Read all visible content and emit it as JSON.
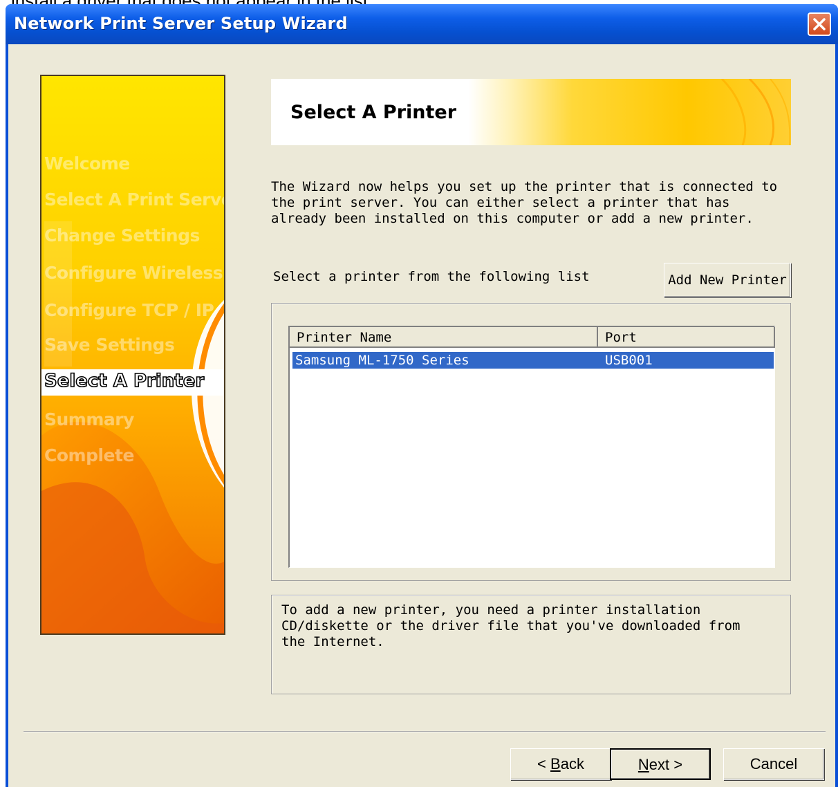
{
  "overflow_text": "install a driver that does not appear in the list.",
  "window": {
    "title": "Network Print Server Setup Wizard"
  },
  "sidebar": {
    "steps": [
      {
        "label": "Welcome"
      },
      {
        "label": "Select A Print Server"
      },
      {
        "label": "Change Settings"
      },
      {
        "label": "Configure Wireless"
      },
      {
        "label": "Configure  TCP / IP"
      },
      {
        "label": "Save Settings"
      },
      {
        "label": "Select A Printer"
      },
      {
        "label": "Summary"
      },
      {
        "label": "Complete"
      }
    ],
    "active_step": "Select A Printer"
  },
  "header": {
    "title": "Select A Printer"
  },
  "description": "The Wizard now helps you set up the printer that is connected to\nthe print server. You can either select a printer that has\nalready been installed on this computer or add a new printer.",
  "printer_list": {
    "label": "Select a printer from the following list",
    "add_button": "Add New Printer",
    "columns": [
      "Printer Name",
      "Port"
    ],
    "rows": [
      {
        "name": "Samsung ML-1750 Series",
        "port": "USB001",
        "selected": true
      }
    ]
  },
  "note": "To add a new printer, you need a printer installation\nCD/diskette or the driver file that you've downloaded from\nthe Internet.",
  "buttons": {
    "back_prefix": "< ",
    "back_mnemonic": "B",
    "back_rest": "ack",
    "next_mnemonic": "N",
    "next_rest": "ext >",
    "cancel": "Cancel"
  },
  "colors": {
    "titlebar": "#0a4fd6",
    "selection": "#3168c8",
    "dialog_bg": "#ece9d8",
    "banner_accent": "#f5a800"
  }
}
